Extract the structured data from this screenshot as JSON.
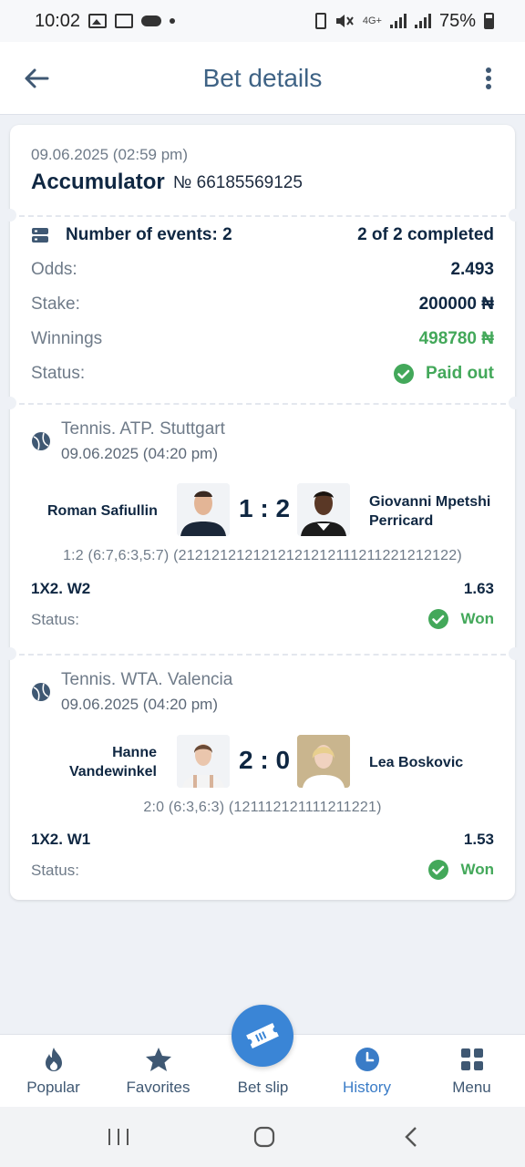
{
  "status_bar": {
    "time": "10:02",
    "network": "4G+",
    "battery": "75%"
  },
  "appbar": {
    "title": "Bet details",
    "back_icon": "arrow-left-icon",
    "more_icon": "more-vertical-icon"
  },
  "bet": {
    "date": "09.06.2025 (02:59 pm)",
    "type": "Accumulator",
    "number": "№ 66185569125",
    "events_label": "Number of events: 2",
    "completed": "2 of 2 completed",
    "odds_label": "Odds:",
    "odds_value": "2.493",
    "stake_label": "Stake:",
    "stake_value": "200000 ₦",
    "winnings_label": "Winnings",
    "winnings_value": "498780 ₦",
    "status_label": "Status:",
    "status_value": "Paid out"
  },
  "events": [
    {
      "league": "Tennis. ATP. Stuttgart",
      "date": "09.06.2025 (04:20 pm)",
      "player1": "Roman Safiullin",
      "player2_line1": "Giovanni Mpetshi",
      "player2_line2": "Perricard",
      "score": "1 : 2",
      "detail": "1:2 (6:7,6:3,5:7) (2121212121212121212111211221212122)",
      "market": "1X2. W2",
      "odd": "1.63",
      "status_label": "Status:",
      "status_value": "Won"
    },
    {
      "league": "Tennis. WTA. Valencia",
      "date": "09.06.2025 (04:20 pm)",
      "player1_line1": "Hanne",
      "player1_line2": "Vandewinkel",
      "player2": "Lea Boskovic",
      "score": "2 : 0",
      "detail": "2:0 (6:3,6:3) (121112121111211221)",
      "market": "1X2. W1",
      "odd": "1.53",
      "status_label": "Status:",
      "status_value": "Won"
    }
  ],
  "bottom_nav": {
    "popular": "Popular",
    "favorites": "Favorites",
    "bet_slip": "Bet slip",
    "history": "History",
    "menu": "Menu"
  },
  "colors": {
    "accent": "#3a85d6",
    "success": "#43a85a",
    "title": "#3f6385"
  }
}
